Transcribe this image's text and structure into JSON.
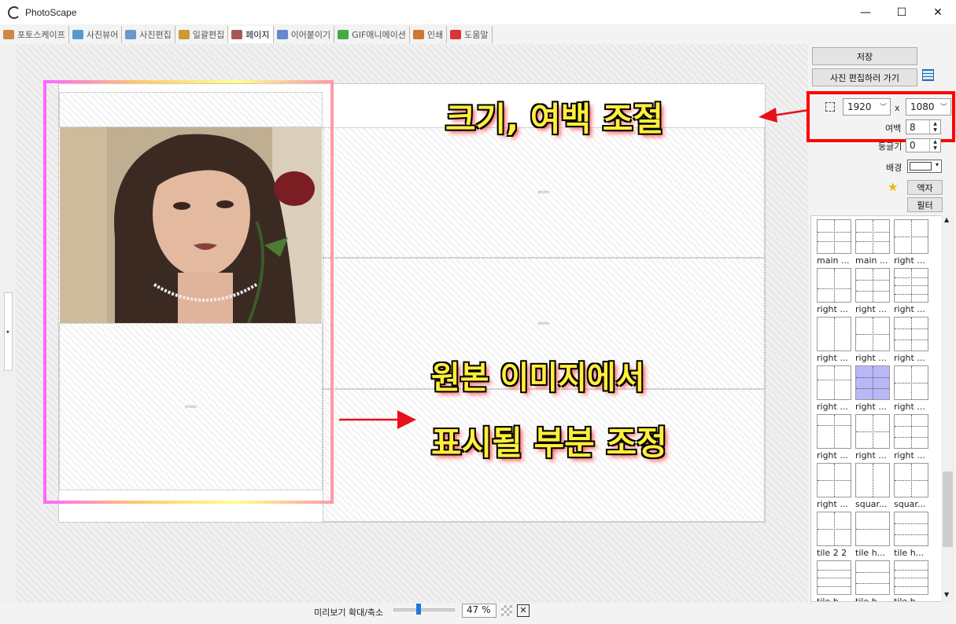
{
  "window": {
    "title": "PhotoScape",
    "minimize": "—",
    "maximize": "☐",
    "close": "✕"
  },
  "tabs": [
    {
      "label": "포토스케이프",
      "color": "#c84"
    },
    {
      "label": "사진뷰어",
      "color": "#59c"
    },
    {
      "label": "사진편집",
      "color": "#69c"
    },
    {
      "label": "일괄편집",
      "color": "#c93"
    },
    {
      "label": "페이지",
      "color": "#a55"
    },
    {
      "label": "이어붙이기",
      "color": "#68c"
    },
    {
      "label": "GIF애니메이션",
      "color": "#4a4"
    },
    {
      "label": "인쇄",
      "color": "#c73"
    },
    {
      "label": "도움말",
      "color": "#d33"
    }
  ],
  "sidebar": {
    "save": "저장",
    "go_edit": "사진 편집하러 가기",
    "width": "1920",
    "x_sep": "x",
    "height": "1080",
    "margin_label": "여백",
    "margin_value": "8",
    "round_label": "둥글기",
    "round_value": "0",
    "bg_label": "배경",
    "frame_btn": "액자",
    "filter_btn": "필터"
  },
  "templates": [
    "main ...",
    "main ...",
    "right ...",
    "right ...",
    "right ...",
    "right ...",
    "right ...",
    "right ...",
    "right ...",
    "right ...",
    "right ...",
    "right ...",
    "right ...",
    "right ...",
    "right ...",
    "right ...",
    "squar...",
    "squar...",
    "tile 2 2",
    "tile h...",
    "tile h...",
    "tile h...",
    "tile h...",
    "tile h..."
  ],
  "selected_template": 10,
  "cells": {
    "placeholder": "photo"
  },
  "annotations": {
    "size_margin": "크기, 여백 조절",
    "line1": "원본 이미지에서",
    "line2": "표시될 부분 조정"
  },
  "bottom": {
    "zoom_label": "미리보기 확대/축소",
    "zoom_value": "47 %",
    "zoom_level": 0.47
  },
  "colors": {
    "highlight_box": "#ff0000",
    "arrow": "#e8101a",
    "selected_template": "#b8b8f8"
  }
}
